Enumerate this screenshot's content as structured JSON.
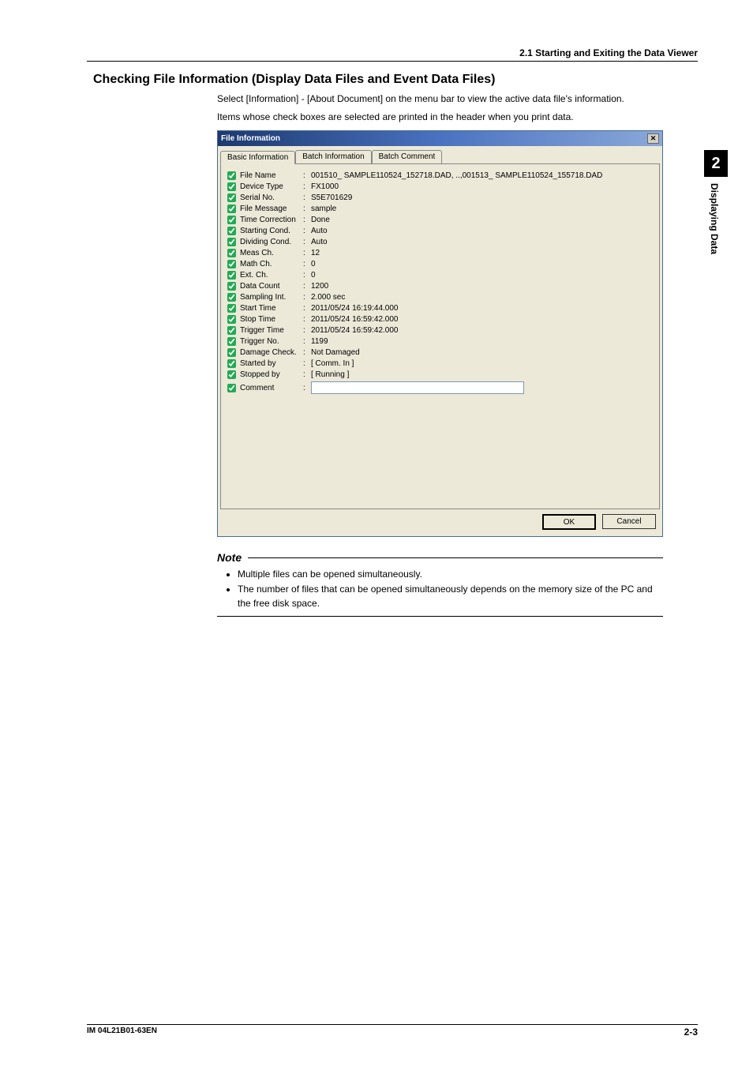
{
  "section_header": "2.1  Starting and Exiting the Data Viewer",
  "heading": "Checking File Information (Display Data Files and Event Data Files)",
  "body_para_1": "Select [Information] - [About Document] on the menu bar to view the active data file's information.",
  "body_para_2": "Items whose check boxes are selected are printed in the header when you print data.",
  "dialog": {
    "title": "File Information",
    "tabs": [
      "Basic Information",
      "Batch Information",
      "Batch Comment"
    ],
    "rows": [
      {
        "label": "File Name",
        "value": "001510_ SAMPLE110524_152718.DAD, ..,001513_ SAMPLE110524_155718.DAD"
      },
      {
        "label": "Device Type",
        "value": "FX1000"
      },
      {
        "label": "Serial No.",
        "value": "S5E701629"
      },
      {
        "label": "File Message",
        "value": "sample"
      },
      {
        "label": "Time Correction",
        "value": "Done"
      },
      {
        "label": "Starting Cond.",
        "value": "Auto"
      },
      {
        "label": "Dividing Cond.",
        "value": "Auto"
      },
      {
        "label": "Meas Ch.",
        "value": "12"
      },
      {
        "label": "Math Ch.",
        "value": "0"
      },
      {
        "label": "Ext. Ch.",
        "value": "0"
      },
      {
        "label": "Data Count",
        "value": "1200"
      },
      {
        "label": "Sampling Int.",
        "value": "2.000 sec"
      },
      {
        "label": "Start Time",
        "value": "2011/05/24 16:19:44.000"
      },
      {
        "label": "Stop Time",
        "value": "2011/05/24 16:59:42.000"
      },
      {
        "label": "Trigger Time",
        "value": "2011/05/24 16:59:42.000"
      },
      {
        "label": "Trigger No.",
        "value": "1199"
      },
      {
        "label": "Damage Check.",
        "value": "Not Damaged"
      },
      {
        "label": "Started by",
        "value": "[ Comm. In ]"
      },
      {
        "label": "Stopped by",
        "value": "[ Running ]"
      },
      {
        "label": "Comment",
        "value": "",
        "input": true
      }
    ],
    "buttons": {
      "ok": "OK",
      "cancel": "Cancel"
    }
  },
  "note": {
    "title": "Note",
    "items": [
      "Multiple files can be opened simultaneously.",
      "The number of files that can be opened simultaneously depends on the memory size of the PC and the free disk space."
    ]
  },
  "side": {
    "chapter": "2",
    "label": "Displaying Data"
  },
  "footer": {
    "left": "IM 04L21B01-63EN",
    "right": "2-3"
  }
}
